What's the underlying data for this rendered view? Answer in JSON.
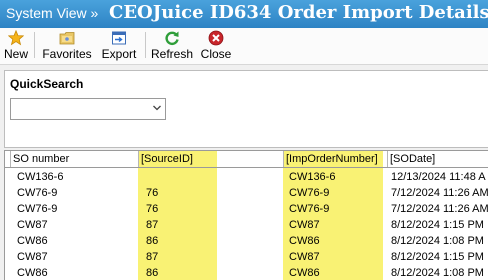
{
  "header": {
    "breadcrumb": "System View »",
    "title": "CEOJuice ID634 Order Import Details"
  },
  "toolbar": {
    "new": "New",
    "favorites": "Favorites",
    "export": "Export",
    "refresh": "Refresh",
    "close": "Close"
  },
  "quicksearch": {
    "label": "QuickSearch",
    "selected": ""
  },
  "grid": {
    "columns": [
      "SO number",
      "[SourceID]",
      "[ImpOrderNumber]",
      "[SODate]"
    ],
    "rows": [
      [
        "CW136-6",
        "",
        "CW136-6",
        "12/13/2024 11:48 A"
      ],
      [
        "CW76-9",
        "76",
        "CW76-9",
        "7/12/2024 11:26 AM"
      ],
      [
        "CW76-9",
        "76",
        "CW76-9",
        "7/12/2024 11:26 AM"
      ],
      [
        "CW87",
        "87",
        "CW87",
        "8/12/2024 1:15 PM"
      ],
      [
        "CW86",
        "86",
        "CW86",
        "8/12/2024 1:08 PM"
      ],
      [
        "CW87",
        "87",
        "CW87",
        "8/12/2024 1:15 PM"
      ],
      [
        "CW86",
        "86",
        "CW86",
        "8/12/2024 1:08 PM"
      ]
    ]
  }
}
